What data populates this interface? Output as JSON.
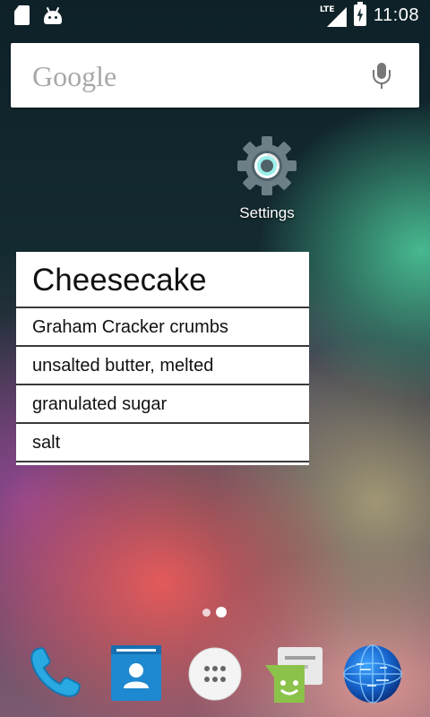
{
  "status_bar": {
    "network": "LTE",
    "time": "11:08",
    "left_icons": [
      "sd-card-icon",
      "android-debug-icon"
    ],
    "right_icons": [
      "signal-icon",
      "battery-charging-icon"
    ]
  },
  "search_bar": {
    "logo_text": "Google",
    "mic_icon": "mic-icon"
  },
  "home_apps": [
    {
      "label": "Settings",
      "icon": "settings-gear-icon"
    }
  ],
  "recipe_widget": {
    "title": "Cheesecake",
    "ingredients": [
      "Graham Cracker crumbs",
      "unsalted butter, melted",
      "granulated sugar",
      "salt"
    ]
  },
  "page_indicator": {
    "pages": 2,
    "active_page": 2
  },
  "dock": {
    "items": [
      {
        "icon": "phone-icon"
      },
      {
        "icon": "contacts-icon"
      },
      {
        "icon": "app-drawer-icon"
      },
      {
        "icon": "messaging-icon"
      },
      {
        "icon": "browser-globe-icon"
      }
    ]
  },
  "colors": {
    "widget_background": "#ffffff",
    "settings_accent": "#8ee8e0",
    "phone_blue": "#1e9bd7",
    "messaging_green": "#8bc34a"
  }
}
